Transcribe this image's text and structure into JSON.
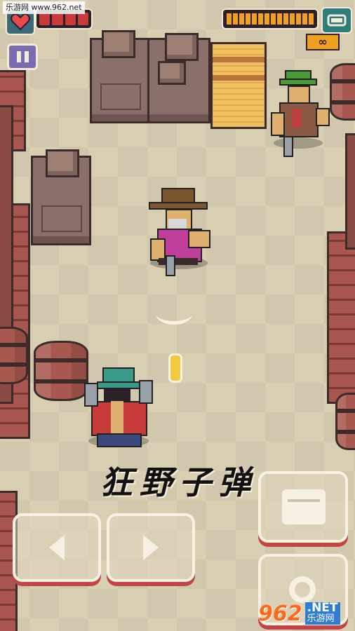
{
  "watermark": {
    "text": "乐游网 www.962.net"
  },
  "game": {
    "title": "狂野子弹"
  },
  "hud": {
    "health": {
      "icon": "heart-icon",
      "segments_total": 4,
      "segments_filled": 4,
      "color": "#c83b3b"
    },
    "ammo": {
      "segments_total": 14,
      "segments_filled": 14,
      "color": "#f0a020"
    },
    "weapon": {
      "icon": "gun-icon",
      "ammo_label": "∞"
    },
    "pause": {
      "icon": "pause-icon"
    }
  },
  "controls": {
    "move_left": {
      "icon": "arrow-left-icon"
    },
    "move_right": {
      "icon": "arrow-right-icon"
    },
    "punch": {
      "icon": "fist-icon"
    },
    "special": {
      "icon": "gear-icon"
    }
  },
  "logo": {
    "num": "962",
    "net": ".NET",
    "cn": "乐游网"
  },
  "colors": {
    "accent_red": "#c24545",
    "floor": "#d8cfb3",
    "wall": "#a8564f"
  }
}
